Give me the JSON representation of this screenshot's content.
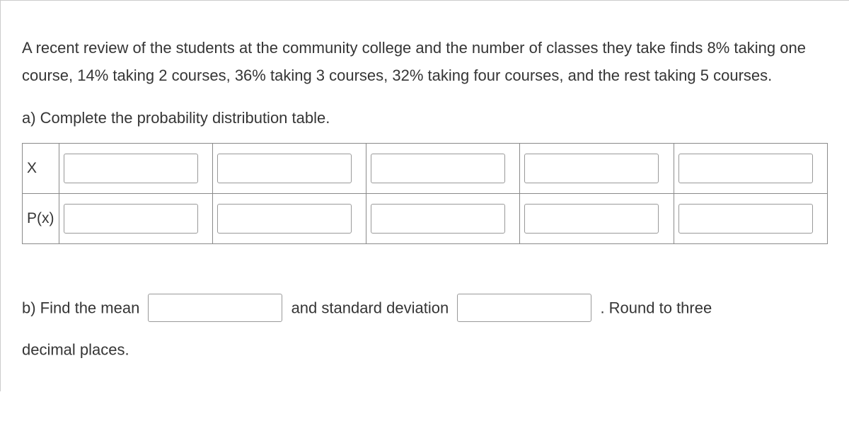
{
  "question": {
    "intro": "A recent review of the students at the community college and the number of classes they take finds 8% taking one course, 14% taking 2 courses, 36% taking 3 courses, 32% taking four courses, and the rest taking 5 courses.",
    "part_a": "a) Complete the probability distribution table.",
    "table": {
      "row1_label": "X",
      "row2_label": "P(x)"
    },
    "part_b": {
      "prefix": "b) Find the mean",
      "middle": "and standard deviation",
      "suffix": ". Round to three",
      "line2": "decimal places."
    }
  }
}
